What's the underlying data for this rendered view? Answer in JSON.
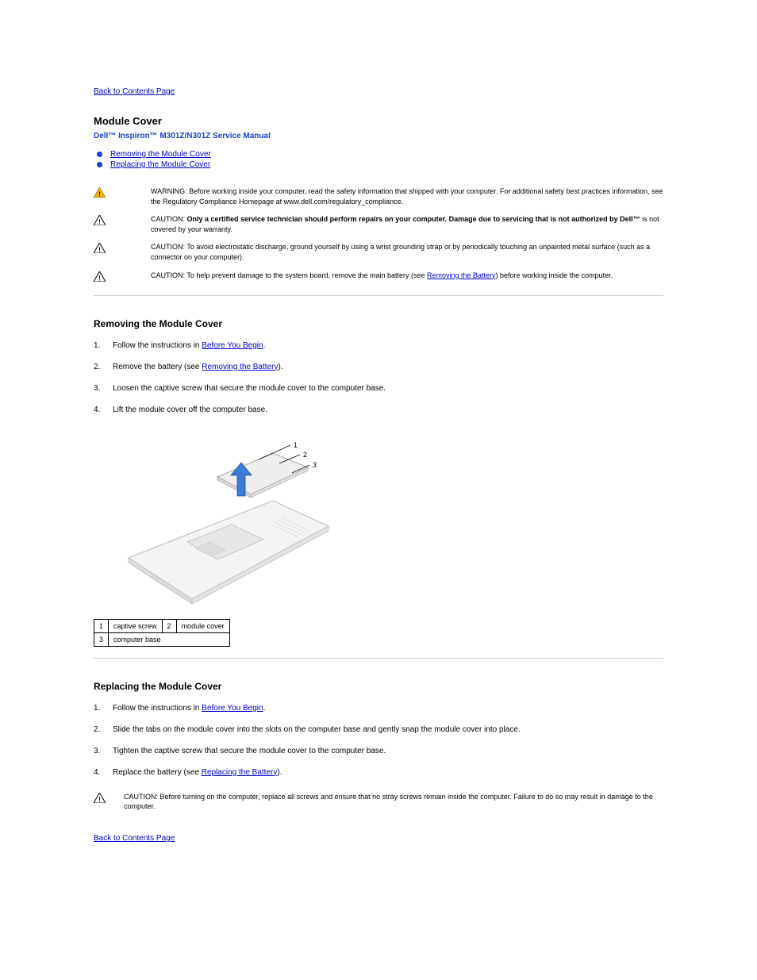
{
  "nav": {
    "back_top": "Back to Contents Page",
    "back_bottom": "Back to Contents Page"
  },
  "header": {
    "section": "Module Cover",
    "manual": "Dell™ Inspiron™ M301Z/N301Z Service Manual"
  },
  "toc": [
    {
      "label": "Removing the Module Cover"
    },
    {
      "label": "Replacing the Module Cover"
    }
  ],
  "notices": {
    "warning": "WARNING: Before working inside your computer, read the safety information that shipped with your computer. For additional safety best practices information, see the Regulatory Compliance Homepage at www.dell.com/regulatory_compliance.",
    "caution1_prefix": "CAUTION: ",
    "caution1_bold": "Only a certified service technician should perform repairs on your computer. Damage due to servicing that is not authorized by Dell™",
    "caution1_rest": " is not covered by your warranty.",
    "caution2": "CAUTION: To avoid electrostatic discharge, ground yourself by using a wrist grounding strap or by periodically touching an unpainted metal surface (such as a connector on your computer).",
    "caution3_a": "CAUTION: To help prevent damage to the system board, remove the main battery (see ",
    "caution3_link": "Removing the Battery",
    "caution3_b": ") before working inside the computer."
  },
  "remove": {
    "title": "Removing the Module Cover",
    "steps": [
      {
        "pre": "Follow the instructions in ",
        "link": "Before You Begin",
        "post": "."
      },
      {
        "pre": "Remove the battery (see ",
        "link": "Removing the Battery",
        "post": ")."
      },
      {
        "pre": "Loosen the captive screw that secure the module cover to the computer base.",
        "link": null,
        "post": ""
      },
      {
        "pre": "Lift the module cover off the computer base.",
        "link": null,
        "post": ""
      }
    ]
  },
  "legend": {
    "r1c1": "1",
    "r1c2": "captive screw",
    "r1c3": "2",
    "r1c4": "module cover",
    "r2c1": "3",
    "r2c2": "computer base"
  },
  "replace": {
    "title": "Replacing the Module Cover",
    "steps": [
      {
        "pre": "Follow the instructions in ",
        "link": "Before You Begin",
        "post": "."
      },
      {
        "pre": "Slide the tabs on the module cover into the slots on the computer base and gently snap the module cover into place.",
        "link": null,
        "post": ""
      },
      {
        "pre": "Tighten the captive screw that secure the module cover to the computer base.",
        "link": null,
        "post": ""
      },
      {
        "pre": "Replace the battery (see ",
        "link": "Replacing the Battery",
        "post": ")."
      }
    ],
    "caution": "CAUTION: Before turning on the computer, replace all screws and ensure that no stray screws remain inside the computer. Failure to do so may result in damage to the computer."
  }
}
